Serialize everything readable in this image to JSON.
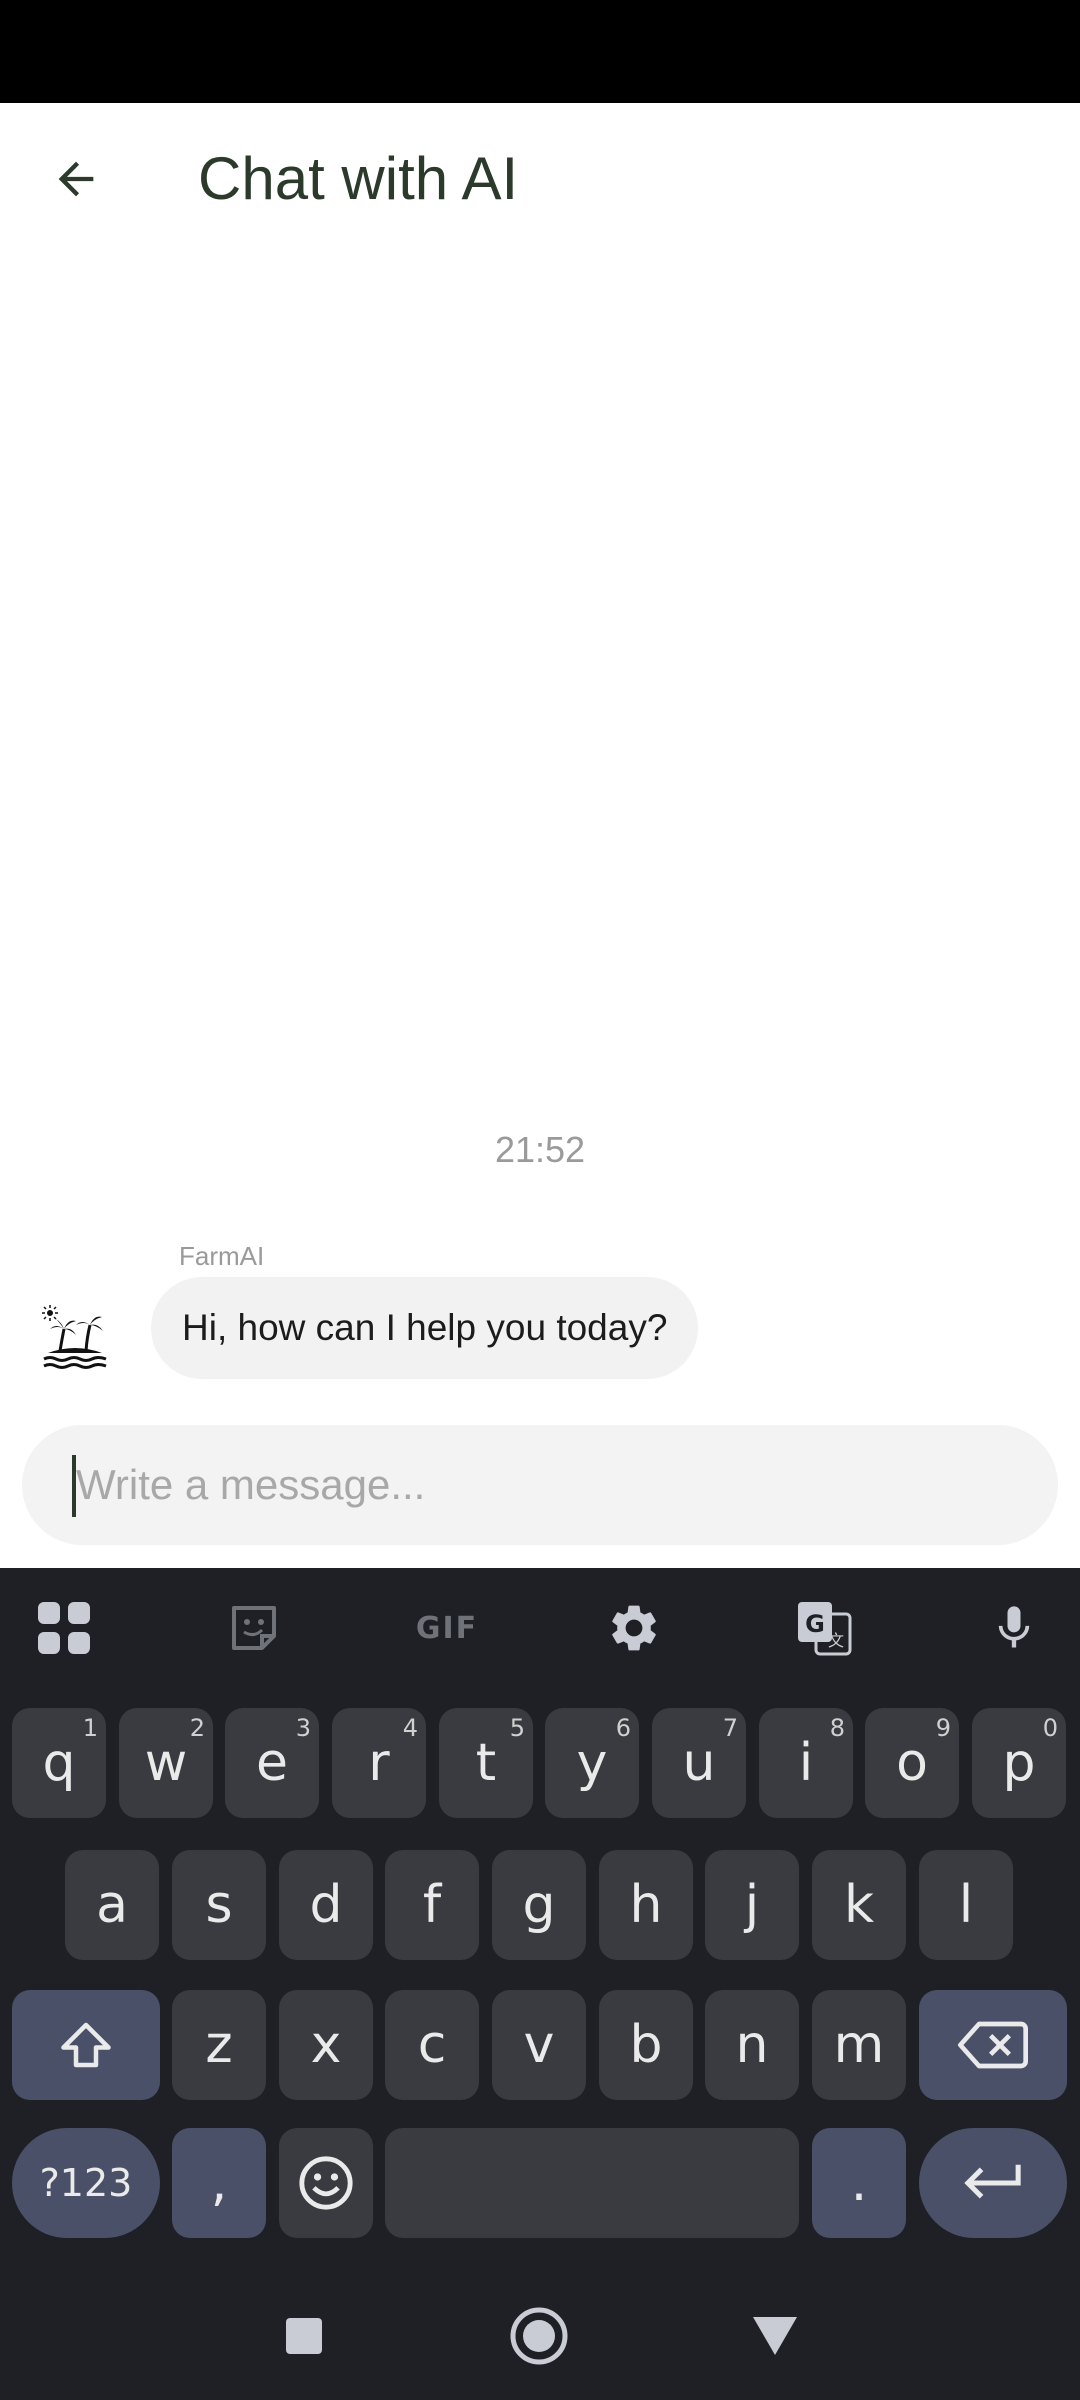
{
  "app_bar": {
    "title": "Chat with AI",
    "back_icon": "arrow-back-icon"
  },
  "chat": {
    "timestamp": "21:52",
    "messages": [
      {
        "sender": "FarmAI",
        "text": "Hi, how can I help you today?",
        "avatar_icon": "island-palm-icon"
      }
    ]
  },
  "composer": {
    "placeholder": "Write a message...",
    "value": ""
  },
  "keyboard": {
    "toolbar": [
      "apps-grid-icon",
      "sticker-icon",
      "GIF",
      "settings-gear-icon",
      "translate-icon",
      "microphone-icon"
    ],
    "gif_label": "GIF",
    "row1": [
      {
        "key": "q",
        "hint": "1"
      },
      {
        "key": "w",
        "hint": "2"
      },
      {
        "key": "e",
        "hint": "3"
      },
      {
        "key": "r",
        "hint": "4"
      },
      {
        "key": "t",
        "hint": "5"
      },
      {
        "key": "y",
        "hint": "6"
      },
      {
        "key": "u",
        "hint": "7"
      },
      {
        "key": "i",
        "hint": "8"
      },
      {
        "key": "o",
        "hint": "9"
      },
      {
        "key": "p",
        "hint": "0"
      }
    ],
    "row2": [
      "a",
      "s",
      "d",
      "f",
      "g",
      "h",
      "j",
      "k",
      "l"
    ],
    "row3": [
      "z",
      "x",
      "c",
      "v",
      "b",
      "n",
      "m"
    ],
    "symbols_label": "?123",
    "comma_label": ",",
    "period_label": ".",
    "shift_icon": "shift-arrow-icon",
    "backspace_icon": "backspace-icon",
    "emoji_icon": "emoji-smile-icon",
    "enter_icon": "enter-return-icon"
  },
  "nav": {
    "recents_icon": "square-recents-icon",
    "home_icon": "circle-home-icon",
    "back_icon": "triangle-back-icon"
  },
  "colors": {
    "title_text": "#2b3a2b",
    "keyboard_bg": "#1e2026",
    "key_bg": "#3a3b40",
    "function_key_bg": "#4a5068",
    "bubble_bg": "#f2f2f2"
  }
}
